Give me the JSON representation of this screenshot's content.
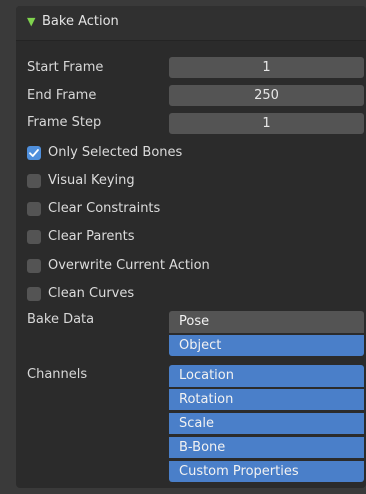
{
  "panel": {
    "title": "Bake Action"
  },
  "frames": [
    {
      "label": "Start Frame",
      "value": "1"
    },
    {
      "label": "End Frame",
      "value": "250"
    },
    {
      "label": "Frame Step",
      "value": "1"
    }
  ],
  "options": [
    {
      "label": "Only Selected Bones",
      "checked": true
    },
    {
      "label": "Visual Keying",
      "checked": false
    },
    {
      "label": "Clear Constraints",
      "checked": false
    },
    {
      "label": "Clear Parents",
      "checked": false
    },
    {
      "label": "Overwrite Current Action",
      "checked": false
    },
    {
      "label": "Clean Curves",
      "checked": false
    }
  ],
  "bake_data": {
    "label": "Bake Data",
    "items": [
      {
        "label": "Pose",
        "selected": false
      },
      {
        "label": "Object",
        "selected": true
      }
    ]
  },
  "channels": {
    "label": "Channels",
    "items": [
      {
        "label": "Location",
        "selected": true
      },
      {
        "label": "Rotation",
        "selected": true
      },
      {
        "label": "Scale",
        "selected": true
      },
      {
        "label": "B-Bone",
        "selected": true
      },
      {
        "label": "Custom Properties",
        "selected": true
      }
    ]
  },
  "colors": {
    "accent": "#4a7fc9",
    "checkbox_on": "#4f8fdc",
    "field_bg": "#545454",
    "panel_bg": "#2b2b2b",
    "header_arrow": "#7fd34e"
  },
  "icons": {
    "header_arrow": "triangle-down-icon",
    "checkmark": "checkmark-icon"
  }
}
